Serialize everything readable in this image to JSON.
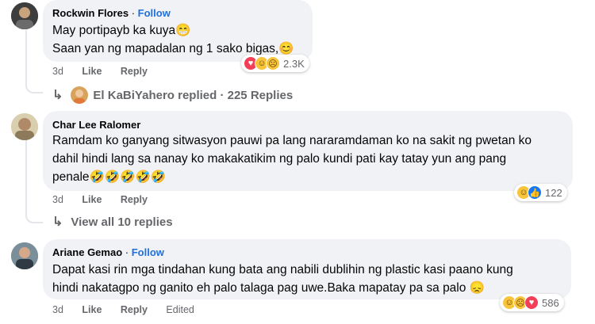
{
  "comments": [
    {
      "author": "Rockwin Flores",
      "follow": "Follow",
      "lines": [
        "May portipayb ka kuya😁",
        "Saan yan ng mapadalan ng 1 sako bigas,😊"
      ],
      "time": "3d",
      "like": "Like",
      "reply": "Reply",
      "reactions": [
        "love",
        "haha",
        "sad"
      ],
      "reaction_count": "2.3K",
      "replies_by": "El KaBiYahero replied · 225 Replies"
    },
    {
      "author": "Char Lee Ralomer",
      "lines": [
        "Ramdam ko ganyang sitwasyon pauwi pa lang nararamdaman ko na sakit ng pwetan ko",
        "dahil hindi lang sa nanay ko makakatikim ng palo kundi pati kay tatay yun ang pang",
        "penale🤣🤣🤣🤣🤣"
      ],
      "time": "3d",
      "like": "Like",
      "reply": "Reply",
      "reactions": [
        "haha",
        "like"
      ],
      "reaction_count": "122",
      "view_replies": "View all 10 replies"
    },
    {
      "author": "Ariane Gemao",
      "follow": "Follow",
      "lines": [
        "Dapat kasi rin mga tindahan kung bata ang nabili dublihin ng plastic kasi paano kung",
        "hindi nakatagpo ng ganito eh palo talaga pag uwe.Baka mapatay pa sa palo 😞"
      ],
      "time": "3d",
      "like": "Like",
      "reply": "Reply",
      "edited": "Edited",
      "reactions": [
        "haha",
        "sad",
        "love"
      ],
      "reaction_count": "586"
    }
  ],
  "colors": {
    "link": "#216fdb",
    "meta": "#65676b",
    "bubble": "#f0f2f5",
    "like": "#1877f2",
    "love": "#f33e58",
    "haha": "#f7c43c"
  },
  "icons": [
    "reply-arrow-icon",
    "like-reaction-icon",
    "love-reaction-icon",
    "haha-reaction-icon",
    "sad-reaction-icon"
  ]
}
